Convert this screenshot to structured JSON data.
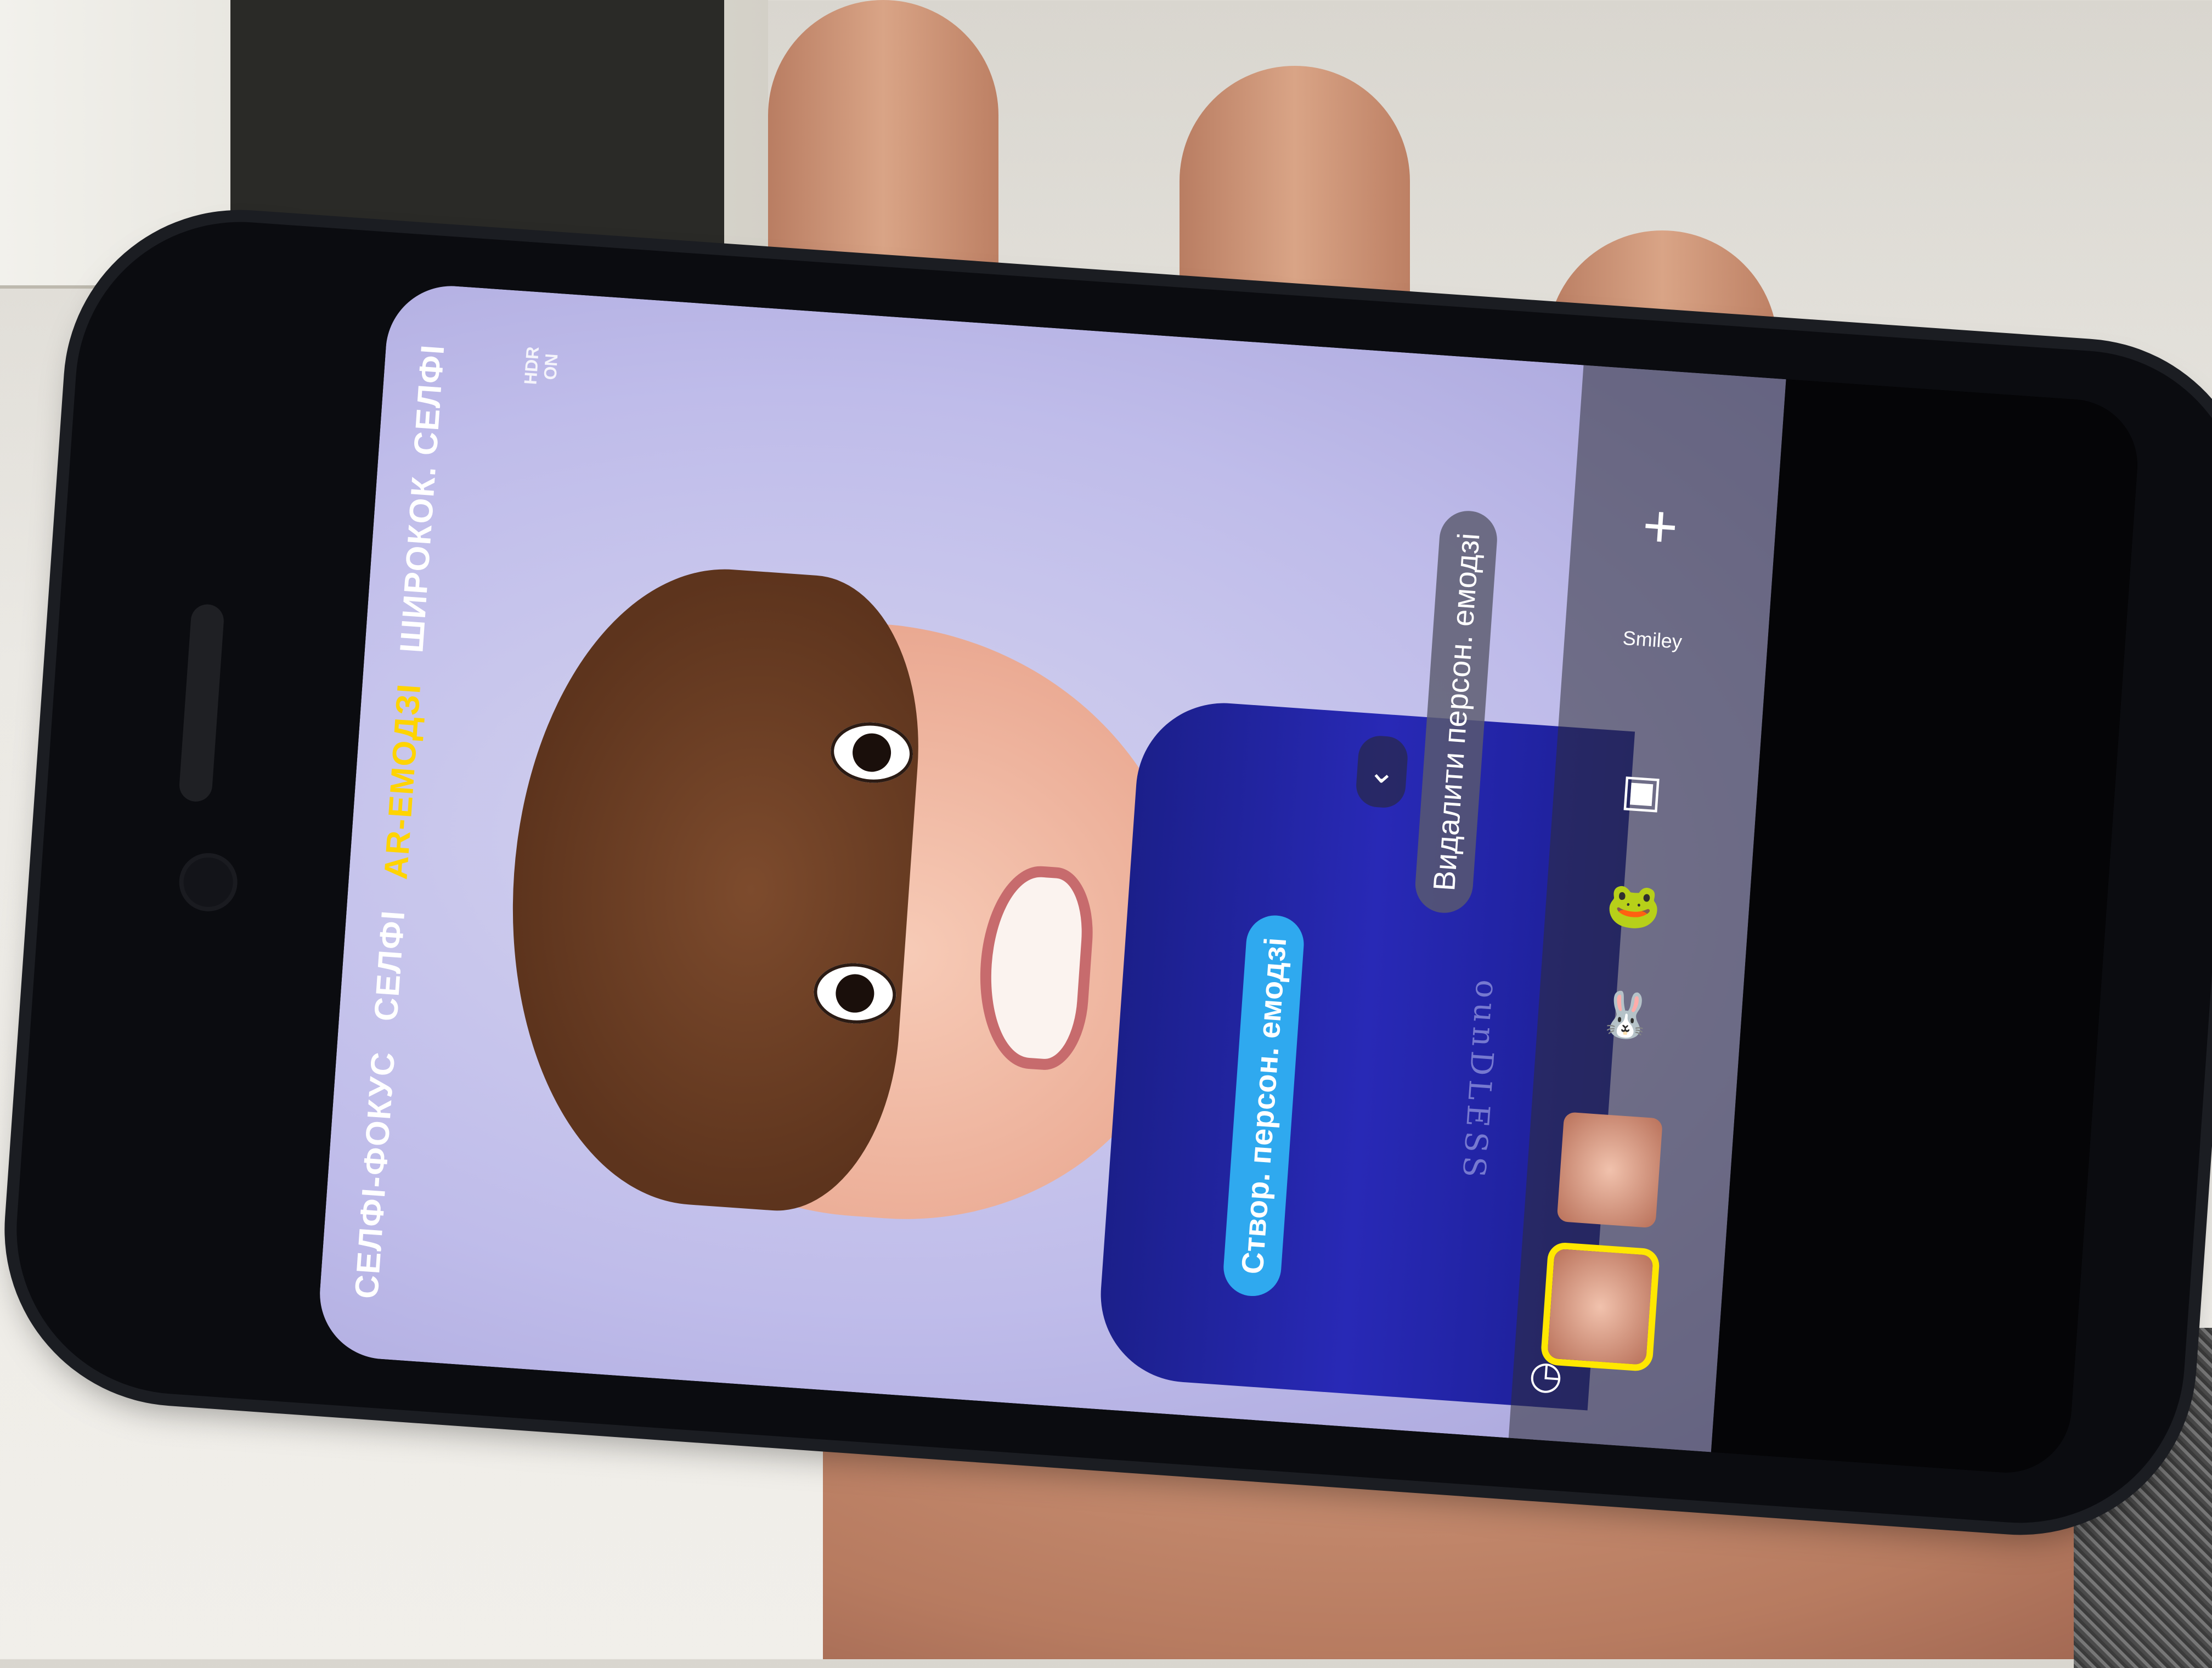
{
  "camera": {
    "modes": [
      "СЕЛФІ-ФОКУС",
      "СЕЛФІ",
      "AR-ЕМОДЗІ",
      "ШИРОКОК. СЕЛФІ"
    ],
    "active_mode": "AR-ЕМОДЗІ",
    "hdr": {
      "line1": "HDR",
      "line2": "ON"
    },
    "create_emoji_label": "Створ. персон. емодзі",
    "delete_emoji_label": "Видалити персон. емодзі",
    "shirt_text": "ounDLESS",
    "plus_label": "+",
    "sticker_label": "Smiley"
  },
  "colors": {
    "active_mode": "#ffd400",
    "create_pill": "#2fa9ef",
    "record": "#e41b2b"
  },
  "icons": [
    "settings-icon",
    "timer-icon",
    "switch-camera-icon",
    "back-icon",
    "record-icon",
    "shutter-button",
    "gallery-thumbnail",
    "expand-icon",
    "plus-icon",
    "chevron-down-icon"
  ]
}
